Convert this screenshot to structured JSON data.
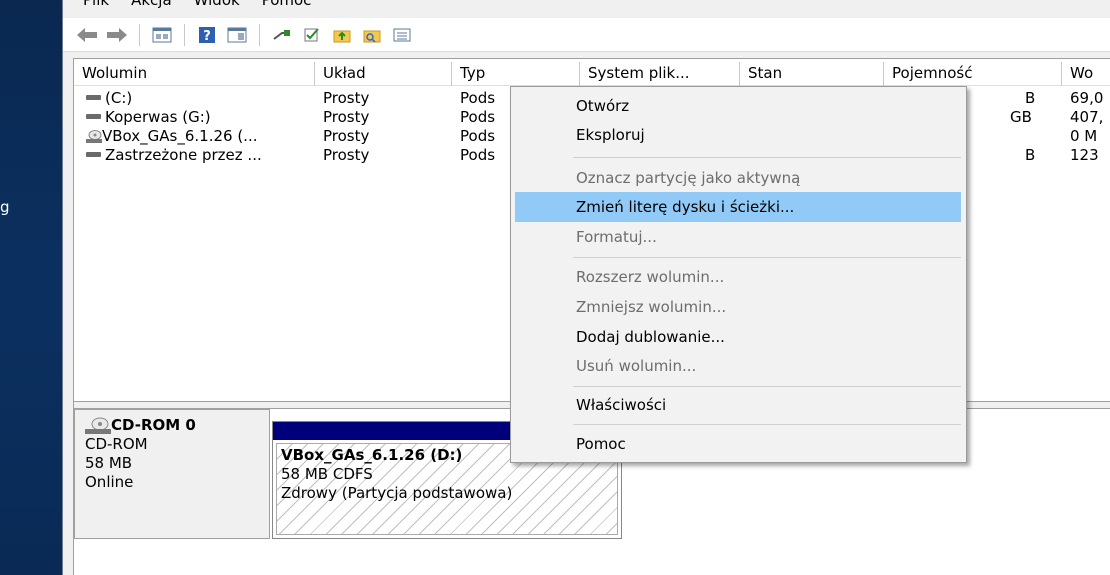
{
  "desktop": {
    "fragment": "g"
  },
  "menubar": [
    "Plik",
    "Akcja",
    "Widok",
    "Pomoc"
  ],
  "toolbar": [
    "back-arrow-icon",
    "forward-arrow-icon",
    "show-hide-console-tree-icon",
    "help-icon",
    "properties-icon",
    "connect-icon",
    "check-icon",
    "up-folder-icon",
    "search-folder-icon",
    "view-list-icon"
  ],
  "list": {
    "columns": [
      "Wolumin",
      "Układ",
      "Typ",
      "System plik...",
      "Stan",
      "Pojemność",
      "Wo"
    ],
    "rows": [
      {
        "volume": "(C:)",
        "layout": "Prosty",
        "type": "Pods",
        "capacity": "B",
        "free": "69,0",
        "icon": "drive-icon"
      },
      {
        "volume": "Koperwas (G:)",
        "layout": "Prosty",
        "type": "Pods",
        "capacity": "GB",
        "free": "407,",
        "icon": "drive-icon"
      },
      {
        "volume": "VBox_GAs_6.1.26 (...",
        "layout": "Prosty",
        "type": "Pods",
        "capacity": "",
        "free": "0 M",
        "icon": "cd-icon"
      },
      {
        "volume": "Zastrzeżone przez ...",
        "layout": "Prosty",
        "type": "Pods",
        "capacity": "B",
        "free": "123",
        "icon": "drive-icon"
      }
    ]
  },
  "disk": {
    "name": "CD-ROM 0",
    "kind": "CD-ROM",
    "size": "58 MB",
    "status": "Online",
    "partition": {
      "name": "VBox_GAs_6.1.26 (D:)",
      "fs": "58 MB CDFS",
      "health": "Zdrowy (Partycja podstawowa)"
    }
  },
  "context_menu": {
    "open": "Otwórz",
    "explore": "Eksploruj",
    "mark_active": "Oznacz partycję jako aktywną",
    "change_letter": "Zmień literę dysku i ścieżki...",
    "format": "Formatuj...",
    "extend": "Rozszerz wolumin...",
    "shrink": "Zmniejsz wolumin...",
    "add_mirror": "Dodaj dublowanie...",
    "delete": "Usuń wolumin...",
    "properties": "Właściwości",
    "help": "Pomoc"
  },
  "colors": {
    "highlight": "#91c9f7",
    "partition_bar": "#00007b",
    "desktop": "#0b2a55"
  }
}
